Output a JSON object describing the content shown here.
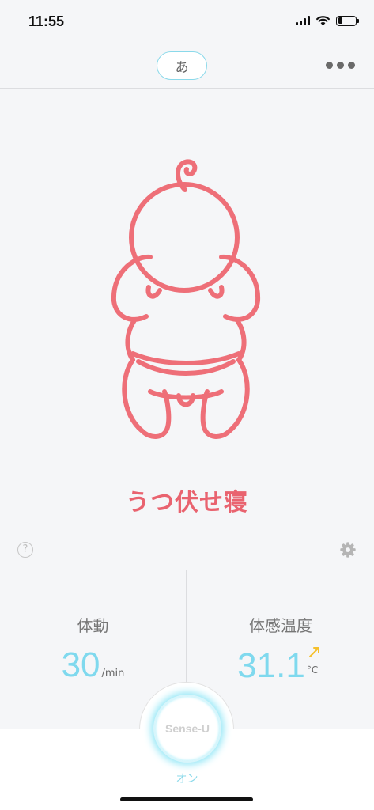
{
  "status_bar": {
    "time": "11:55",
    "battery_level": 0.25
  },
  "nav": {
    "mode_label": "あ",
    "more_icon": "more-dots-icon"
  },
  "baby": {
    "posture": "うつ伏せ寝",
    "color": "#ee6f78",
    "icon": "baby-prone-icon"
  },
  "help": {
    "label": "?"
  },
  "settings": {
    "icon": "gear-icon"
  },
  "stats": {
    "movement": {
      "title": "体動",
      "value": "30",
      "unit": "/min"
    },
    "temperature": {
      "title": "体感温度",
      "value": "31.1",
      "unit": "°C",
      "trend_icon": "trend-up-arrow-icon",
      "trend_color": "#f5c02c"
    }
  },
  "sensor": {
    "label": "Sense-U",
    "state": "オン",
    "glow_color": "#8fe6f6"
  }
}
